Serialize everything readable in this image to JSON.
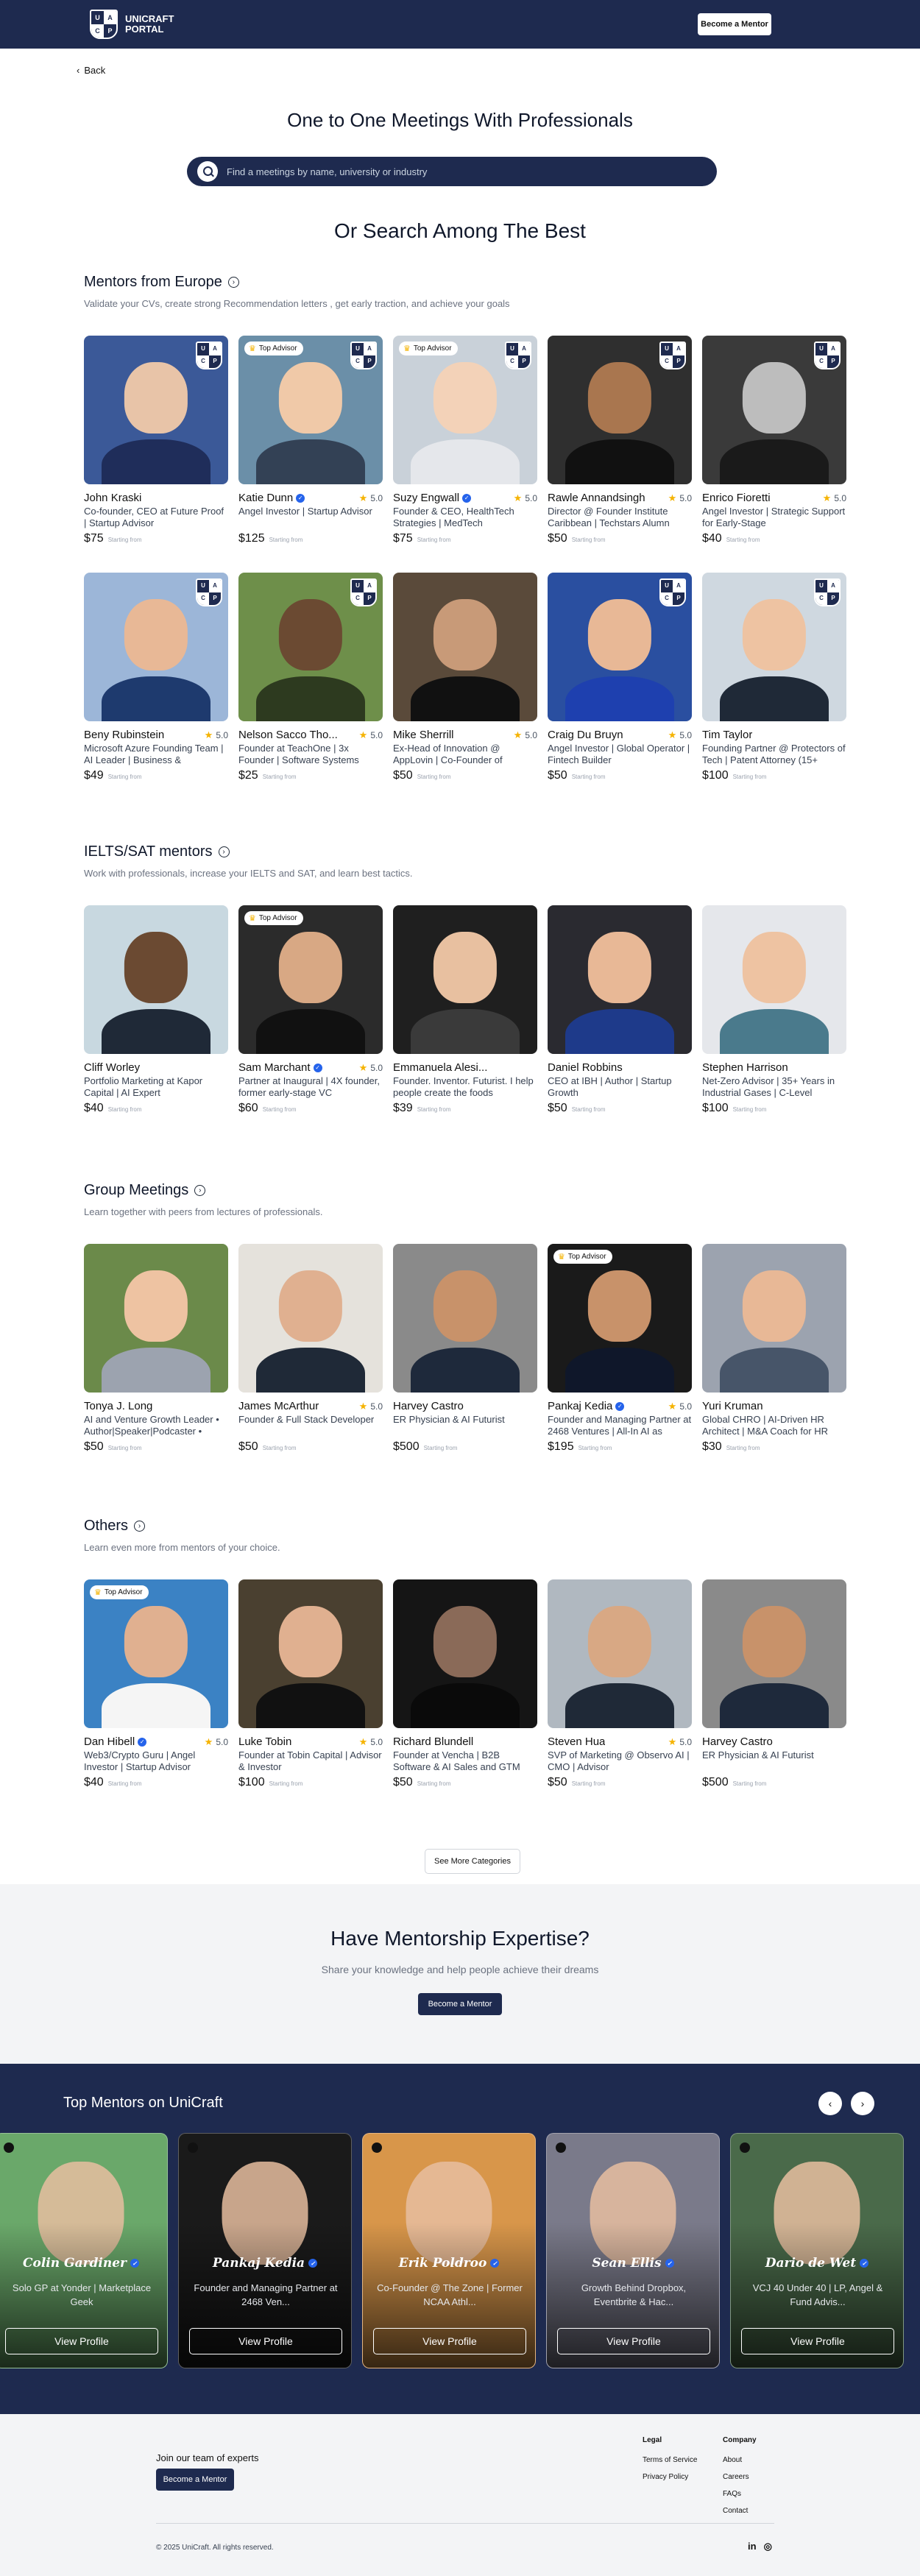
{
  "header": {
    "logo_letters": [
      "U",
      "A",
      "C",
      "P"
    ],
    "logo_text": "UNICRAFT\nPORTAL",
    "cta": "Become a Mentor"
  },
  "back": "Back",
  "page_title": "One to One Meetings With Professionals",
  "search": {
    "placeholder": "Find a meetings by name, university or industry"
  },
  "subtitle": "Or Search Among The Best",
  "price_note": "Starting from",
  "top_advisor": "Top Advisor",
  "sections": [
    {
      "title": "Mentors from Europe",
      "desc": "Validate your CVs, create strong Recommendation letters , get early traction, and achieve your goals",
      "rows": [
        [
          {
            "name": "John Kraski",
            "rating": "",
            "role": "Co-founder, CEO at Future Proof | Startup Advisor",
            "price": "$75",
            "badge": true,
            "top": false,
            "verified": false,
            "bg": "#3b5998",
            "skin": "#e8c4a8",
            "cloth": "#1f2d5a"
          },
          {
            "name": "Katie Dunn",
            "rating": "5.0",
            "role": "Angel Investor | Startup Advisor",
            "price": "$125",
            "badge": true,
            "top": true,
            "verified": true,
            "bg": "#6b8fa8",
            "skin": "#f0c9a8",
            "cloth": "#334155"
          },
          {
            "name": "Suzy Engwall",
            "rating": "5.0",
            "role": "Founder & CEO, HealthTech Strategies | MedTech",
            "price": "$75",
            "badge": true,
            "top": true,
            "verified": true,
            "bg": "#c9d1d9",
            "skin": "#f3d2b8",
            "cloth": "#e5e7eb"
          },
          {
            "name": "Rawle Annandsingh",
            "rating": "5.0",
            "role": "Director @ Founder Institute Caribbean | Techstars Alumn",
            "price": "$50",
            "badge": true,
            "top": false,
            "verified": false,
            "bg": "#2f2f2f",
            "skin": "#a9764f",
            "cloth": "#111111"
          },
          {
            "name": "Enrico Fioretti",
            "rating": "5.0",
            "role": "Angel Investor | Strategic Support for Early-Stage",
            "price": "$40",
            "badge": true,
            "top": false,
            "verified": false,
            "bg": "#3a3a3a",
            "skin": "#bdbdbd",
            "cloth": "#1a1a1a"
          }
        ],
        [
          {
            "name": "Beny Rubinstein",
            "rating": "5.0",
            "role": "Microsoft Azure Founding Team | AI Leader | Business &",
            "price": "$49",
            "badge": true,
            "top": false,
            "verified": false,
            "bg": "#9cb6d8",
            "skin": "#e8b896",
            "cloth": "#1e3a6e"
          },
          {
            "name": "Nelson Sacco Tho...",
            "rating": "5.0",
            "role": "Founder at TeachOne | 3x Founder | Software Systems",
            "price": "$25",
            "badge": true,
            "top": false,
            "verified": false,
            "bg": "#6e8f4a",
            "skin": "#6b4a32",
            "cloth": "#2d3a1f"
          },
          {
            "name": "Mike Sherrill",
            "rating": "5.0",
            "role": "Ex-Head of Innovation @ AppLovin | Co-Founder of",
            "price": "$50",
            "badge": false,
            "top": false,
            "verified": false,
            "bg": "#5a4a3a",
            "skin": "#c89a78",
            "cloth": "#111111"
          },
          {
            "name": "Craig Du Bruyn",
            "rating": "5.0",
            "role": "Angel Investor | Global Operator | Fintech Builder",
            "price": "$50",
            "badge": true,
            "top": false,
            "verified": false,
            "bg": "#2a4fa0",
            "skin": "#e8b896",
            "cloth": "#1e40af"
          },
          {
            "name": "Tim Taylor",
            "rating": "",
            "role": "Founding Partner @ Protectors of Tech | Patent Attorney (15+",
            "price": "$100",
            "badge": true,
            "top": false,
            "verified": false,
            "bg": "#cfd8e0",
            "skin": "#eec3a2",
            "cloth": "#1f2937"
          }
        ]
      ]
    },
    {
      "title": "IELTS/SAT mentors",
      "desc": "Work with professionals, increase your IELTS and SAT, and learn best tactics.",
      "rows": [
        [
          {
            "name": "Cliff Worley",
            "rating": "",
            "role": "Portfolio Marketing at Kapor Capital | AI Expert",
            "price": "$40",
            "badge": false,
            "top": false,
            "verified": false,
            "bg": "#c8d8e0",
            "skin": "#6b4a32",
            "cloth": "#1f2937"
          },
          {
            "name": "Sam Marchant",
            "rating": "5.0",
            "role": "Partner at Inaugural | 4X founder, former early-stage VC",
            "price": "$60",
            "badge": false,
            "top": true,
            "verified": true,
            "bg": "#2b2b2b",
            "skin": "#d8a884",
            "cloth": "#111111"
          },
          {
            "name": "Emmanuela Alesi...",
            "rating": "",
            "role": "Founder. Inventor. Futurist. I help people create the foods",
            "price": "$39",
            "badge": false,
            "top": false,
            "verified": false,
            "bg": "#1f1f1f",
            "skin": "#e8c0a0",
            "cloth": "#3a3a3a"
          },
          {
            "name": "Daniel Robbins",
            "rating": "",
            "role": "CEO at IBH | Author | Startup Growth",
            "price": "$50",
            "badge": false,
            "top": false,
            "verified": false,
            "bg": "#2a2a30",
            "skin": "#e8b896",
            "cloth": "#1e3a8a"
          },
          {
            "name": "Stephen Harrison",
            "rating": "",
            "role": "Net-Zero Advisor | 35+ Years in Industrial Gases | C-Level",
            "price": "$100",
            "badge": false,
            "top": false,
            "verified": false,
            "bg": "#e5e7eb",
            "skin": "#eec3a2",
            "cloth": "#4a7a8c"
          }
        ]
      ]
    },
    {
      "title": "Group Meetings",
      "desc": "Learn together with peers from lectures of professionals.",
      "rows": [
        [
          {
            "name": "Tonya J. Long",
            "rating": "",
            "role": "AI and Venture Growth Leader • Author|Speaker|Podcaster •",
            "price": "$50",
            "badge": false,
            "top": false,
            "verified": false,
            "bg": "#6b8a4a",
            "skin": "#eec3a2",
            "cloth": "#9ca3af"
          },
          {
            "name": "James McArthur",
            "rating": "5.0",
            "role": "Founder & Full Stack Developer",
            "price": "$50",
            "badge": false,
            "top": false,
            "verified": false,
            "bg": "#e5e2dc",
            "skin": "#e0b090",
            "cloth": "#1f2937"
          },
          {
            "name": "Harvey Castro",
            "rating": "",
            "role": "ER Physician & AI Futurist",
            "price": "$500",
            "badge": false,
            "top": false,
            "verified": false,
            "bg": "#8a8a8a",
            "skin": "#c8926a",
            "cloth": "#1e293b"
          },
          {
            "name": "Pankaj Kedia",
            "rating": "5.0",
            "role": "Founder and Managing Partner at 2468 Ventures | All-In AI as",
            "price": "$195",
            "badge": false,
            "top": true,
            "verified": true,
            "bg": "#1a1a1a",
            "skin": "#c8926a",
            "cloth": "#0f172a"
          },
          {
            "name": "Yuri Kruman",
            "rating": "",
            "role": "Global CHRO | AI-Driven HR Architect | M&A Coach for HR",
            "price": "$30",
            "badge": false,
            "top": false,
            "verified": false,
            "bg": "#9ca3af",
            "skin": "#e8b896",
            "cloth": "#475569"
          }
        ]
      ]
    },
    {
      "title": "Others",
      "desc": "Learn even more from mentors of your choice.",
      "rows": [
        [
          {
            "name": "Dan Hibell",
            "rating": "5.0",
            "role": "Web3/Crypto Guru | Angel Investor | Startup Advisor",
            "price": "$40",
            "badge": false,
            "top": true,
            "verified": true,
            "bg": "#3b82c4",
            "skin": "#e0b090",
            "cloth": "#f5f5f5"
          },
          {
            "name": "Luke Tobin",
            "rating": "5.0",
            "role": "Founder at Tobin Capital | Advisor & Investor",
            "price": "$100",
            "badge": false,
            "top": false,
            "verified": false,
            "bg": "#4a4030",
            "skin": "#e0b090",
            "cloth": "#111111"
          },
          {
            "name": "Richard Blundell",
            "rating": "",
            "role": "Founder at Vencha | B2B Software & AI Sales and GTM",
            "price": "$50",
            "badge": false,
            "top": false,
            "verified": false,
            "bg": "#151515",
            "skin": "#8a6a58",
            "cloth": "#0a0a0a"
          },
          {
            "name": "Steven Hua",
            "rating": "5.0",
            "role": "SVP of Marketing @ Observo AI | CMO | Advisor",
            "price": "$50",
            "badge": false,
            "top": false,
            "verified": false,
            "bg": "#b0b8c0",
            "skin": "#d8a884",
            "cloth": "#1f2937"
          },
          {
            "name": "Harvey Castro",
            "rating": "",
            "role": "ER Physician & AI Futurist",
            "price": "$500",
            "badge": false,
            "top": false,
            "verified": false,
            "bg": "#8a8a8a",
            "skin": "#c8926a",
            "cloth": "#1e293b"
          }
        ]
      ]
    }
  ],
  "see_more": "See More Categories",
  "expertise": {
    "title": "Have Mentorship Expertise?",
    "desc": "Share your knowledge and help people achieve their dreams",
    "cta": "Become a Mentor"
  },
  "top_mentors": {
    "title": "Top Mentors on UniCraft",
    "view": "View Profile",
    "cards": [
      {
        "name": "Colin Gardiner",
        "role": "Solo GP at Yonder | Marketplace Geek",
        "bg": "#6aa86a"
      },
      {
        "name": "Pankaj Kedia",
        "role": "Founder and Managing Partner at 2468 Ven...",
        "bg": "#1a1a1a"
      },
      {
        "name": "Erik Poldroo",
        "role": "Co-Founder @ The Zone | Former NCAA Athl...",
        "bg": "#d8964a"
      },
      {
        "name": "Sean Ellis",
        "role": "Growth Behind Dropbox, Eventbrite & Hac...",
        "bg": "#7a7a8a"
      },
      {
        "name": "Dario de Wet",
        "role": "VCJ 40 Under 40 | LP, Angel & Fund Advis...",
        "bg": "#4a6a4a"
      }
    ]
  },
  "footer": {
    "join": "Join our team of experts",
    "cta": "Become a Mentor",
    "legal_title": "Legal",
    "legal": [
      "Terms of Service",
      "Privacy Policy"
    ],
    "company_title": "Company",
    "company": [
      "About",
      "Careers",
      "FAQs",
      "Contact"
    ],
    "copyright": "© 2025 UniCraft. All rights reserved.",
    "social": [
      "in",
      "◎"
    ]
  }
}
